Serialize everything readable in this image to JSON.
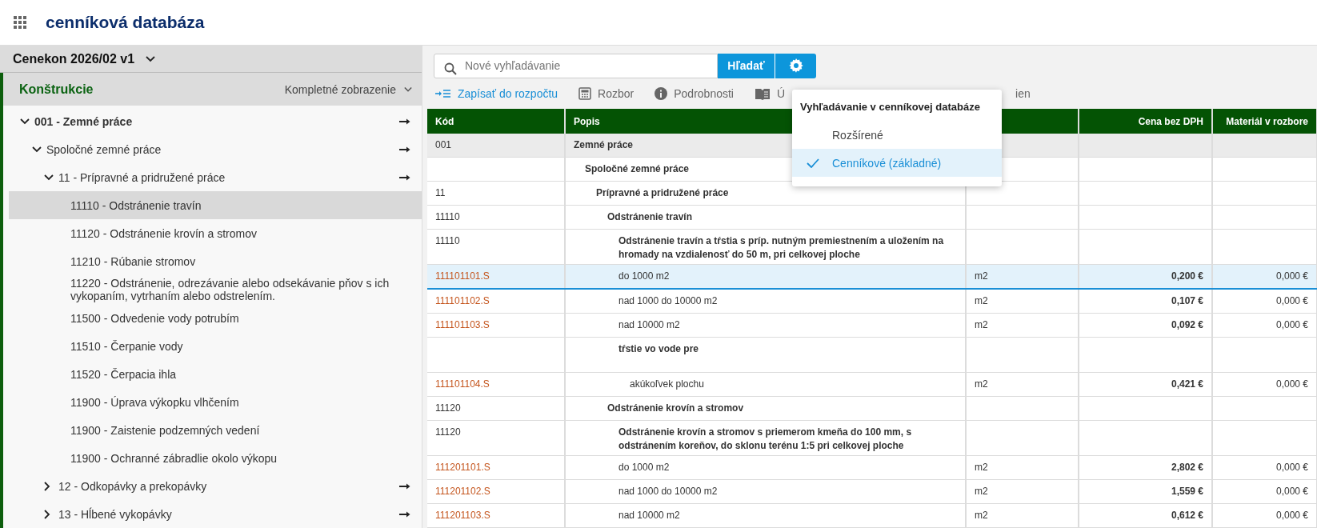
{
  "header": {
    "title": "cenníková databáza"
  },
  "sidebar": {
    "version": "Cenekon 2026/02 v1",
    "section": "Konštrukcie",
    "view": "Kompletné zobrazenie",
    "tree": [
      {
        "label": "001 - Zemné práce",
        "expanded": true,
        "selected": false,
        "children": [
          {
            "label": "Spoločné zemné práce",
            "expanded": true,
            "selected": false,
            "children": [
              {
                "label": "11 - Prípravné a pridružené práce",
                "expanded": true,
                "selected": false,
                "children": [
                  {
                    "label": "11110 - Odstránenie travín",
                    "selected": true
                  },
                  {
                    "label": "11120 - Odstránenie krovín a stromov",
                    "selected": false
                  },
                  {
                    "label": "11210 - Rúbanie stromov",
                    "selected": false
                  },
                  {
                    "label": "11220 - Odstránenie, odrezávanie alebo odsekávanie pňov s ich vykopaním, vytrhaním alebo odstrelením.",
                    "selected": false
                  },
                  {
                    "label": "11500 - Odvedenie vody potrubím",
                    "selected": false
                  },
                  {
                    "label": "11510 - Čerpanie vody",
                    "selected": false
                  },
                  {
                    "label": "11520 - Čerpacia ihla",
                    "selected": false
                  },
                  {
                    "label": "11900 - Úprava výkopku vlhčením",
                    "selected": false
                  },
                  {
                    "label": "11900 - Zaistenie podzemných vedení",
                    "selected": false
                  },
                  {
                    "label": "11900 - Ochranné zábradlie okolo výkopu",
                    "selected": false
                  }
                ]
              },
              {
                "label": "12 - Odkopávky a prekopávky",
                "expanded": false,
                "selected": false
              },
              {
                "label": "13 - Hĺbené vykopávky",
                "expanded": false,
                "selected": false
              }
            ]
          }
        ]
      }
    ]
  },
  "search": {
    "placeholder": "Nové vyhľadávanie",
    "button": "Hľadať"
  },
  "toolbar": [
    {
      "label": "Zapísať do rozpočtu",
      "kind": "write",
      "disabled": false
    },
    {
      "label": "Rozbor",
      "kind": "calculator",
      "disabled": true
    },
    {
      "label": "Podrobnosti",
      "kind": "info",
      "disabled": true
    },
    {
      "label": "Ú",
      "kind": "book",
      "disabled": true
    },
    {
      "label": "ien",
      "kind": "fragment",
      "disabled": true
    }
  ],
  "search_mode_menu": {
    "title": "Vyhľadávanie v cenníkovej databáze",
    "options": [
      {
        "label": "Rozšírené",
        "selected": false
      },
      {
        "label": "Cenníkové (základné)",
        "selected": true
      }
    ]
  },
  "table": {
    "columns": {
      "code": "Kód",
      "description": "Popis",
      "price": "Cena bez DPH",
      "material": "Materiál v rozbore"
    },
    "rows": [
      {
        "kind": "chapter",
        "selected": false,
        "code": "001",
        "description": "Zemné práce"
      },
      {
        "kind": "section",
        "selected": false,
        "description": "Spoločné zemné práce"
      },
      {
        "kind": "group",
        "selected": false,
        "code": "11",
        "description": "Prípravné a pridružené práce"
      },
      {
        "kind": "subgroup",
        "selected": false,
        "code": "11110",
        "description": "Odstránenie travín"
      },
      {
        "kind": "heading",
        "selected": false,
        "code": "11110",
        "description": "Odstránenie travín a tŕstia s príp. nutným premiestnením a uložením na hromady na vzdialenosť do 50 m, pri celkovej ploche"
      },
      {
        "kind": "item",
        "selected": true,
        "code": "111101101.S",
        "description": "do 1000 m2",
        "column_3": "m2",
        "price": "0,200 €",
        "material": "0,000 €"
      },
      {
        "kind": "item",
        "selected": false,
        "code": "111101102.S",
        "description": "nad 1000 do 10000 m2",
        "column_3": "m2",
        "price": "0,107 €",
        "material": "0,000 €"
      },
      {
        "kind": "item",
        "selected": false,
        "code": "111101103.S",
        "description": "nad 10000 m2",
        "column_3": "m2",
        "price": "0,092 €",
        "material": "0,000 €"
      },
      {
        "kind": "heading",
        "selected": false,
        "description": "tŕstie vo vode pre"
      },
      {
        "kind": "subitem",
        "selected": false,
        "code": "111101104.S",
        "description": "akúkoľvek plochu",
        "column_3": "m2",
        "price": "0,421 €",
        "material": "0,000 €"
      },
      {
        "kind": "subgroup",
        "selected": false,
        "code": "11120",
        "description": "Odstránenie krovín a stromov"
      },
      {
        "kind": "heading",
        "selected": false,
        "code": "11120",
        "description": "Odstránenie krovín a stromov s priemerom kmeňa do 100 mm, s odstránením koreňov, do sklonu terénu 1:5 pri celkovej ploche"
      },
      {
        "kind": "item",
        "selected": false,
        "code": "111201101.S",
        "description": "do 1000 m2",
        "column_3": "m2",
        "price": "2,802 €",
        "material": "0,000 €"
      },
      {
        "kind": "item",
        "selected": false,
        "code": "111201102.S",
        "description": "nad 1000 do 10000 m2",
        "column_3": "m2",
        "price": "1,559 €",
        "material": "0,000 €"
      },
      {
        "kind": "item",
        "selected": false,
        "code": "111201103.S",
        "description": "nad 10000 m2",
        "column_3": "m2",
        "price": "0,612 €",
        "material": "0,000 €"
      }
    ]
  }
}
